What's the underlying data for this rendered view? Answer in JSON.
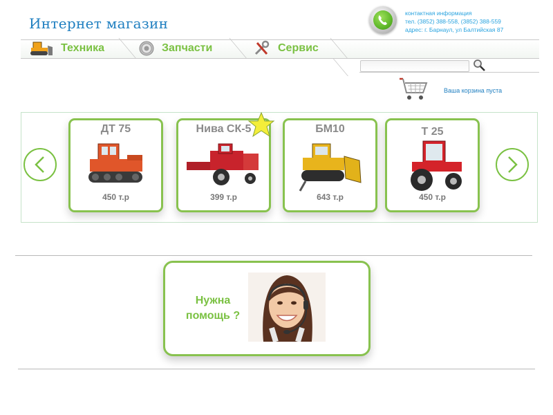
{
  "header": {
    "title": "Интернет магазин",
    "contact": {
      "heading": "контактная информация",
      "phones": "тел. (3852) 388-558, (3852) 388-559",
      "address": "адрес: г. Барнаул, ул Балтийская 87"
    }
  },
  "nav": {
    "items": [
      {
        "label": "Техника",
        "icon": "bulldozer-icon"
      },
      {
        "label": "Запчасти",
        "icon": "gear-icon"
      },
      {
        "label": "Сервис",
        "icon": "tools-icon"
      }
    ]
  },
  "search": {
    "placeholder": ""
  },
  "cart": {
    "status": "Ваша корзина пуста"
  },
  "products": [
    {
      "name": "ДТ 75",
      "price": "450 т.р",
      "image": "crawler-tractor",
      "color": "#e0562a"
    },
    {
      "name": "Нива СК-5",
      "price": "399 т.р",
      "image": "combine-harvester",
      "color": "#c8232c"
    },
    {
      "name": "БМ10",
      "price": "643 т.р",
      "image": "bulldozer",
      "color": "#e8b41c"
    },
    {
      "name": "Т 25",
      "price": "450 т.р",
      "image": "wheeled-tractor",
      "color": "#d4232a"
    }
  ],
  "help": {
    "line1": "Нужна",
    "line2": "помощь ?"
  },
  "colors": {
    "accent_green": "#7ac142",
    "link_blue": "#1f7fc0",
    "contact_blue": "#29a3df"
  }
}
